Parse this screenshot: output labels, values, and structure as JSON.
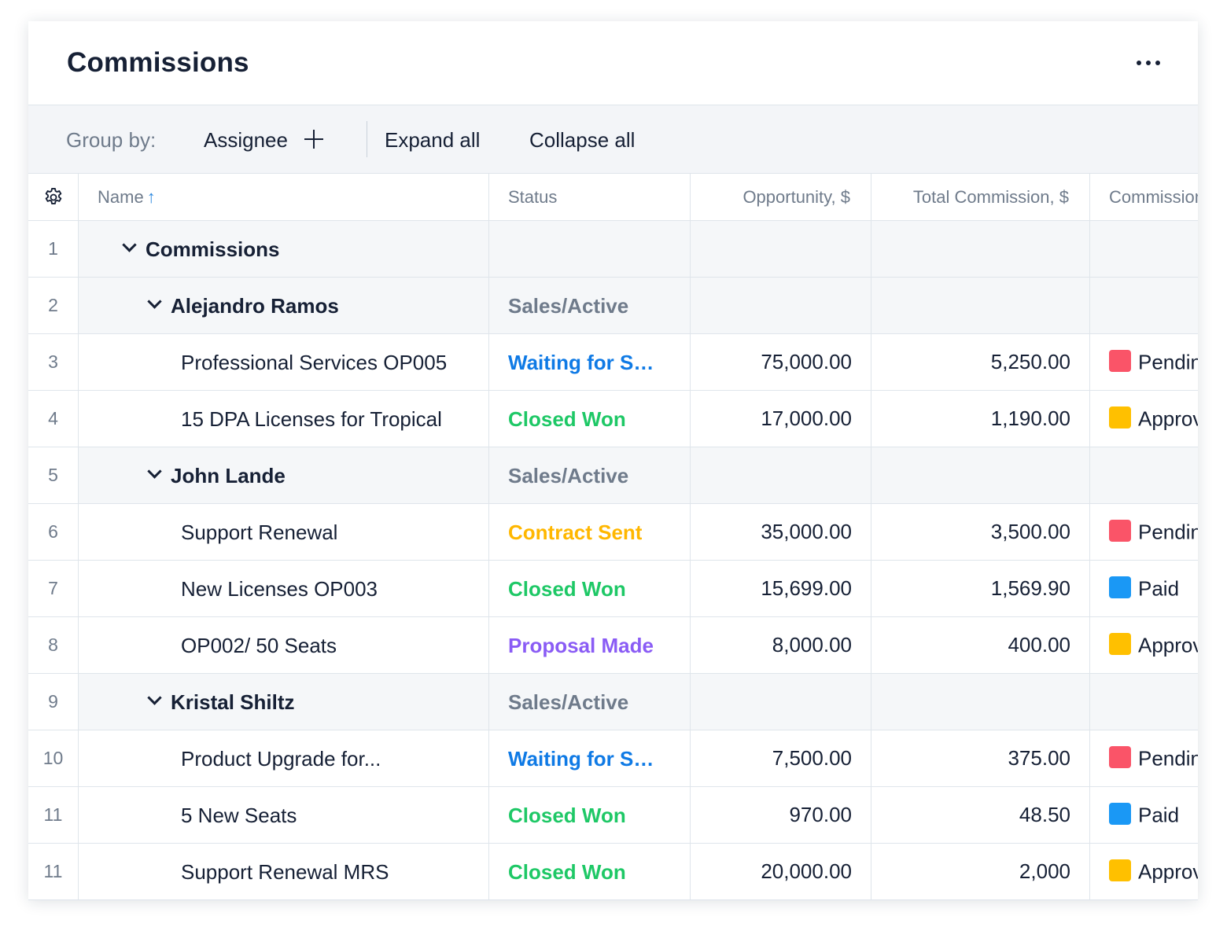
{
  "header": {
    "title": "Commissions",
    "more_icon": "more-horizontal-icon"
  },
  "toolbar": {
    "group_by_label": "Group by:",
    "group_by_value": "Assignee",
    "add_icon": "plus-icon",
    "expand_all": "Expand all",
    "collapse_all": "Collapse all"
  },
  "table": {
    "settings_icon": "gear-icon",
    "sort_icon": "arrow-up-icon",
    "columns": {
      "name": "Name",
      "status": "Status",
      "opportunity": "Opportunity, $",
      "total_commission": "Total Commission, $",
      "commission_status": "Commission Status"
    },
    "colors": {
      "blue_status": "#0f7ae5",
      "green_status": "#1ec866",
      "orange_status": "#ffb700",
      "purple_status": "#8a5cf5",
      "pending": "#fa5468",
      "approved": "#ffc000",
      "paid": "#1a98f5"
    },
    "rows": [
      {
        "num": "1",
        "type": "group0",
        "name": "Commissions",
        "status": ""
      },
      {
        "num": "2",
        "type": "group1",
        "name": "Alejandro Ramos",
        "status": "Sales/Active"
      },
      {
        "num": "3",
        "type": "item",
        "name": "Professional Services OP005",
        "status": "Waiting for Signature",
        "status_color": "#0f7ae5",
        "opportunity": "75,000.00",
        "total": "5,250.00",
        "cstatus": "Pending",
        "cstatus_color": "#fa5468"
      },
      {
        "num": "4",
        "type": "item",
        "name": "15 DPA Licenses for Tropical",
        "status": "Closed Won",
        "status_color": "#1ec866",
        "opportunity": "17,000.00",
        "total": "1,190.00",
        "cstatus": "Approved",
        "cstatus_color": "#ffc000"
      },
      {
        "num": "5",
        "type": "group1",
        "name": "John Lande",
        "status": "Sales/Active"
      },
      {
        "num": "6",
        "type": "item",
        "name": "Support Renewal",
        "status": "Contract Sent",
        "status_color": "#ffb700",
        "opportunity": "35,000.00",
        "total": "3,500.00",
        "cstatus": "Pending",
        "cstatus_color": "#fa5468"
      },
      {
        "num": "7",
        "type": "item",
        "name": "New Licenses OP003",
        "status": "Closed Won",
        "status_color": "#1ec866",
        "opportunity": "15,699.00",
        "total": "1,569.90",
        "cstatus": "Paid",
        "cstatus_color": "#1a98f5"
      },
      {
        "num": "8",
        "type": "item",
        "name": "OP002/ 50 Seats",
        "status": "Proposal Made",
        "status_color": "#8a5cf5",
        "opportunity": "8,000.00",
        "total": "400.00",
        "cstatus": "Approved",
        "cstatus_color": "#ffc000"
      },
      {
        "num": "9",
        "type": "group1",
        "name": "Kristal Shiltz",
        "status": "Sales/Active"
      },
      {
        "num": "10",
        "type": "item",
        "name": "Product Upgrade for...",
        "status": "Waiting for Signature",
        "status_color": "#0f7ae5",
        "opportunity": "7,500.00",
        "total": "375.00",
        "cstatus": "Pending",
        "cstatus_color": "#fa5468"
      },
      {
        "num": "11",
        "type": "item",
        "name": "5 New Seats",
        "status": "Closed Won",
        "status_color": "#1ec866",
        "opportunity": "970.00",
        "total": "48.50",
        "cstatus": "Paid",
        "cstatus_color": "#1a98f5"
      },
      {
        "num": "11",
        "type": "item",
        "name": "Support Renewal MRS",
        "status": "Closed Won",
        "status_color": "#1ec866",
        "opportunity": "20,000.00",
        "total": "2,000",
        "cstatus": "Approved",
        "cstatus_color": "#ffc000"
      }
    ]
  }
}
